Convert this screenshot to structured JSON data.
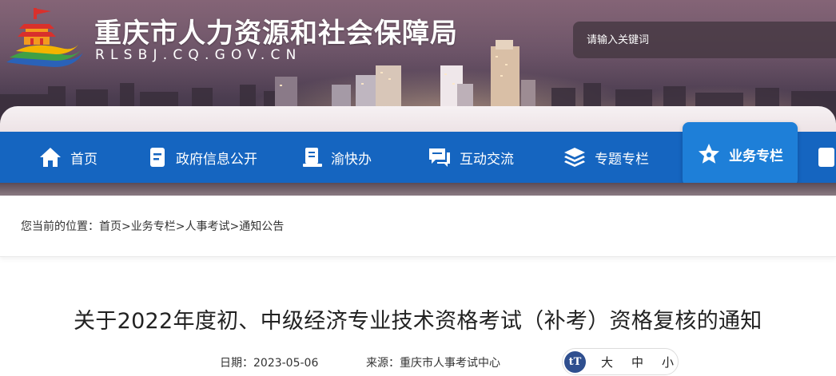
{
  "header": {
    "site_title": "重庆市人力资源和社会保障局",
    "site_domain": "RLSBJ.CQ.GOV.CN",
    "search_placeholder": "请输入关键词"
  },
  "nav": {
    "items": [
      {
        "label": "首页",
        "icon": "home-icon"
      },
      {
        "label": "政府信息公开",
        "icon": "document-icon"
      },
      {
        "label": "渝快办",
        "icon": "service-icon"
      },
      {
        "label": "互动交流",
        "icon": "chat-icon"
      },
      {
        "label": "专题专栏",
        "icon": "layers-icon"
      },
      {
        "label": "业务专栏",
        "icon": "star-icon",
        "active": true
      }
    ]
  },
  "breadcrumb": {
    "prefix": "您当前的位置：",
    "items": [
      "首页",
      "业务专栏",
      "人事考试",
      "通知公告"
    ],
    "separator": ">"
  },
  "article": {
    "title": "关于2022年度初、中级经济专业技术资格考试（补考）资格复核的通知",
    "date_label": "日期：",
    "date": "2023-05-06",
    "source_label": "来源：",
    "source": "重庆市人事考试中心",
    "font_size_icon": "tT",
    "font_sizes": [
      "大",
      "中",
      "小"
    ]
  },
  "colors": {
    "nav_bg": "#1565c0",
    "nav_active": "#1e7fd8",
    "title_text": "#222222"
  }
}
